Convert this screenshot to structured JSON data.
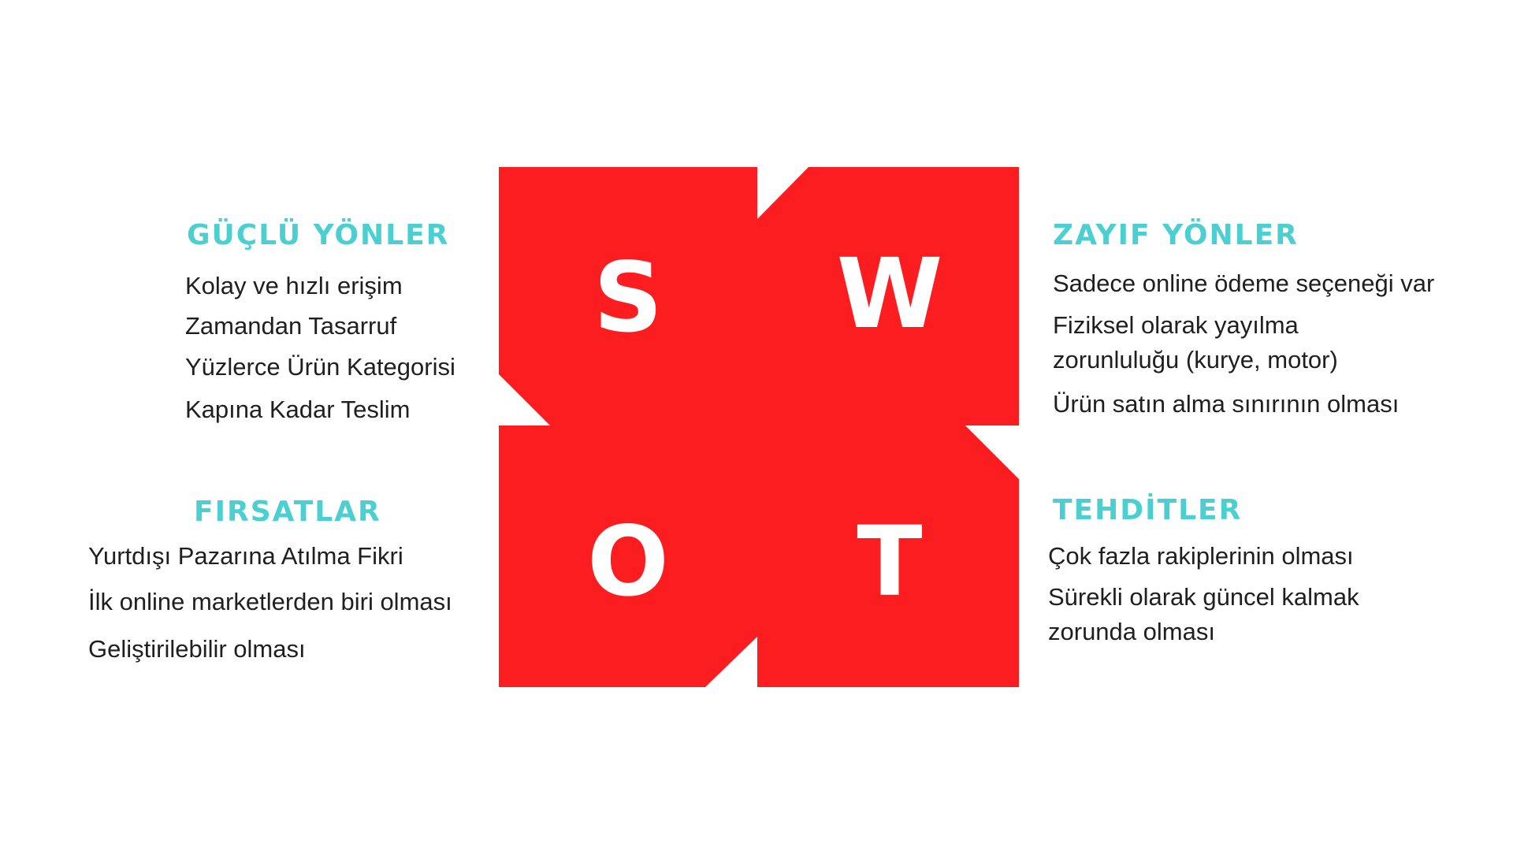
{
  "colors": {
    "heading": "#4ccfd0",
    "block": "#fc1d20",
    "text": "#1f1f1f",
    "background": "#ffffff"
  },
  "letters": {
    "s": "S",
    "w": "W",
    "o": "O",
    "t": "T"
  },
  "strengths": {
    "title": "GÜÇLÜ YÖNLER",
    "items": [
      {
        "lines": [
          "Kolay ve hızlı erişim"
        ]
      },
      {
        "lines": [
          "Zamandan Tasarruf"
        ]
      },
      {
        "lines": [
          "Yüzlerce Ürün Kategorisi"
        ]
      },
      {
        "lines": [
          "Kapına Kadar Teslim"
        ]
      }
    ]
  },
  "weaknesses": {
    "title": "ZAYIF YÖNLER",
    "items": [
      {
        "lines": [
          "Sadece online ödeme seçeneği var"
        ]
      },
      {
        "lines": [
          "Fiziksel olarak yayılma",
          "zorunluluğu (kurye, motor)"
        ]
      },
      {
        "lines": [
          "Ürün satın alma sınırının olması"
        ]
      }
    ]
  },
  "opportunities": {
    "title": "FIRSATLAR",
    "items": [
      {
        "lines": [
          "Yurtdışı Pazarına Atılma Fikri"
        ]
      },
      {
        "lines": [
          "İlk online marketlerden biri olması"
        ]
      },
      {
        "lines": [
          "Geliştirilebilir olması"
        ]
      }
    ]
  },
  "threats": {
    "title": "TEHDİTLER",
    "items": [
      {
        "lines": [
          "Çok fazla rakiplerinin olması"
        ]
      },
      {
        "lines": [
          "Sürekli olarak güncel kalmak",
          " zorunda olması"
        ]
      }
    ]
  }
}
